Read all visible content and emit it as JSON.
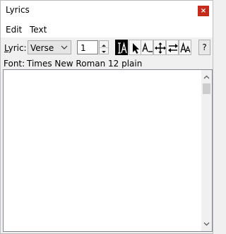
{
  "window": {
    "title": "Lyrics",
    "close_glyph": "×"
  },
  "menu": [
    {
      "label": "Edit"
    },
    {
      "label": "Text"
    }
  ],
  "toolbar": {
    "lyric_label_mnemonic": "L",
    "lyric_label_rest": "yric:",
    "lyric_type": {
      "selected": "Verse"
    },
    "verse_number": "1",
    "tools": [
      {
        "icon": "text-select-icon",
        "selected": true
      },
      {
        "icon": "arrow-pointer-icon",
        "selected": false
      },
      {
        "icon": "text-underscore-icon",
        "selected": false
      },
      {
        "icon": "move-cross-icon",
        "selected": false
      },
      {
        "icon": "swap-arrows-icon",
        "selected": false
      },
      {
        "icon": "font-size-icon",
        "selected": false
      }
    ],
    "help_label": "?"
  },
  "font": {
    "label": "Font:",
    "value": "Times New Roman  12 plain"
  },
  "editor": {
    "text": ""
  }
}
